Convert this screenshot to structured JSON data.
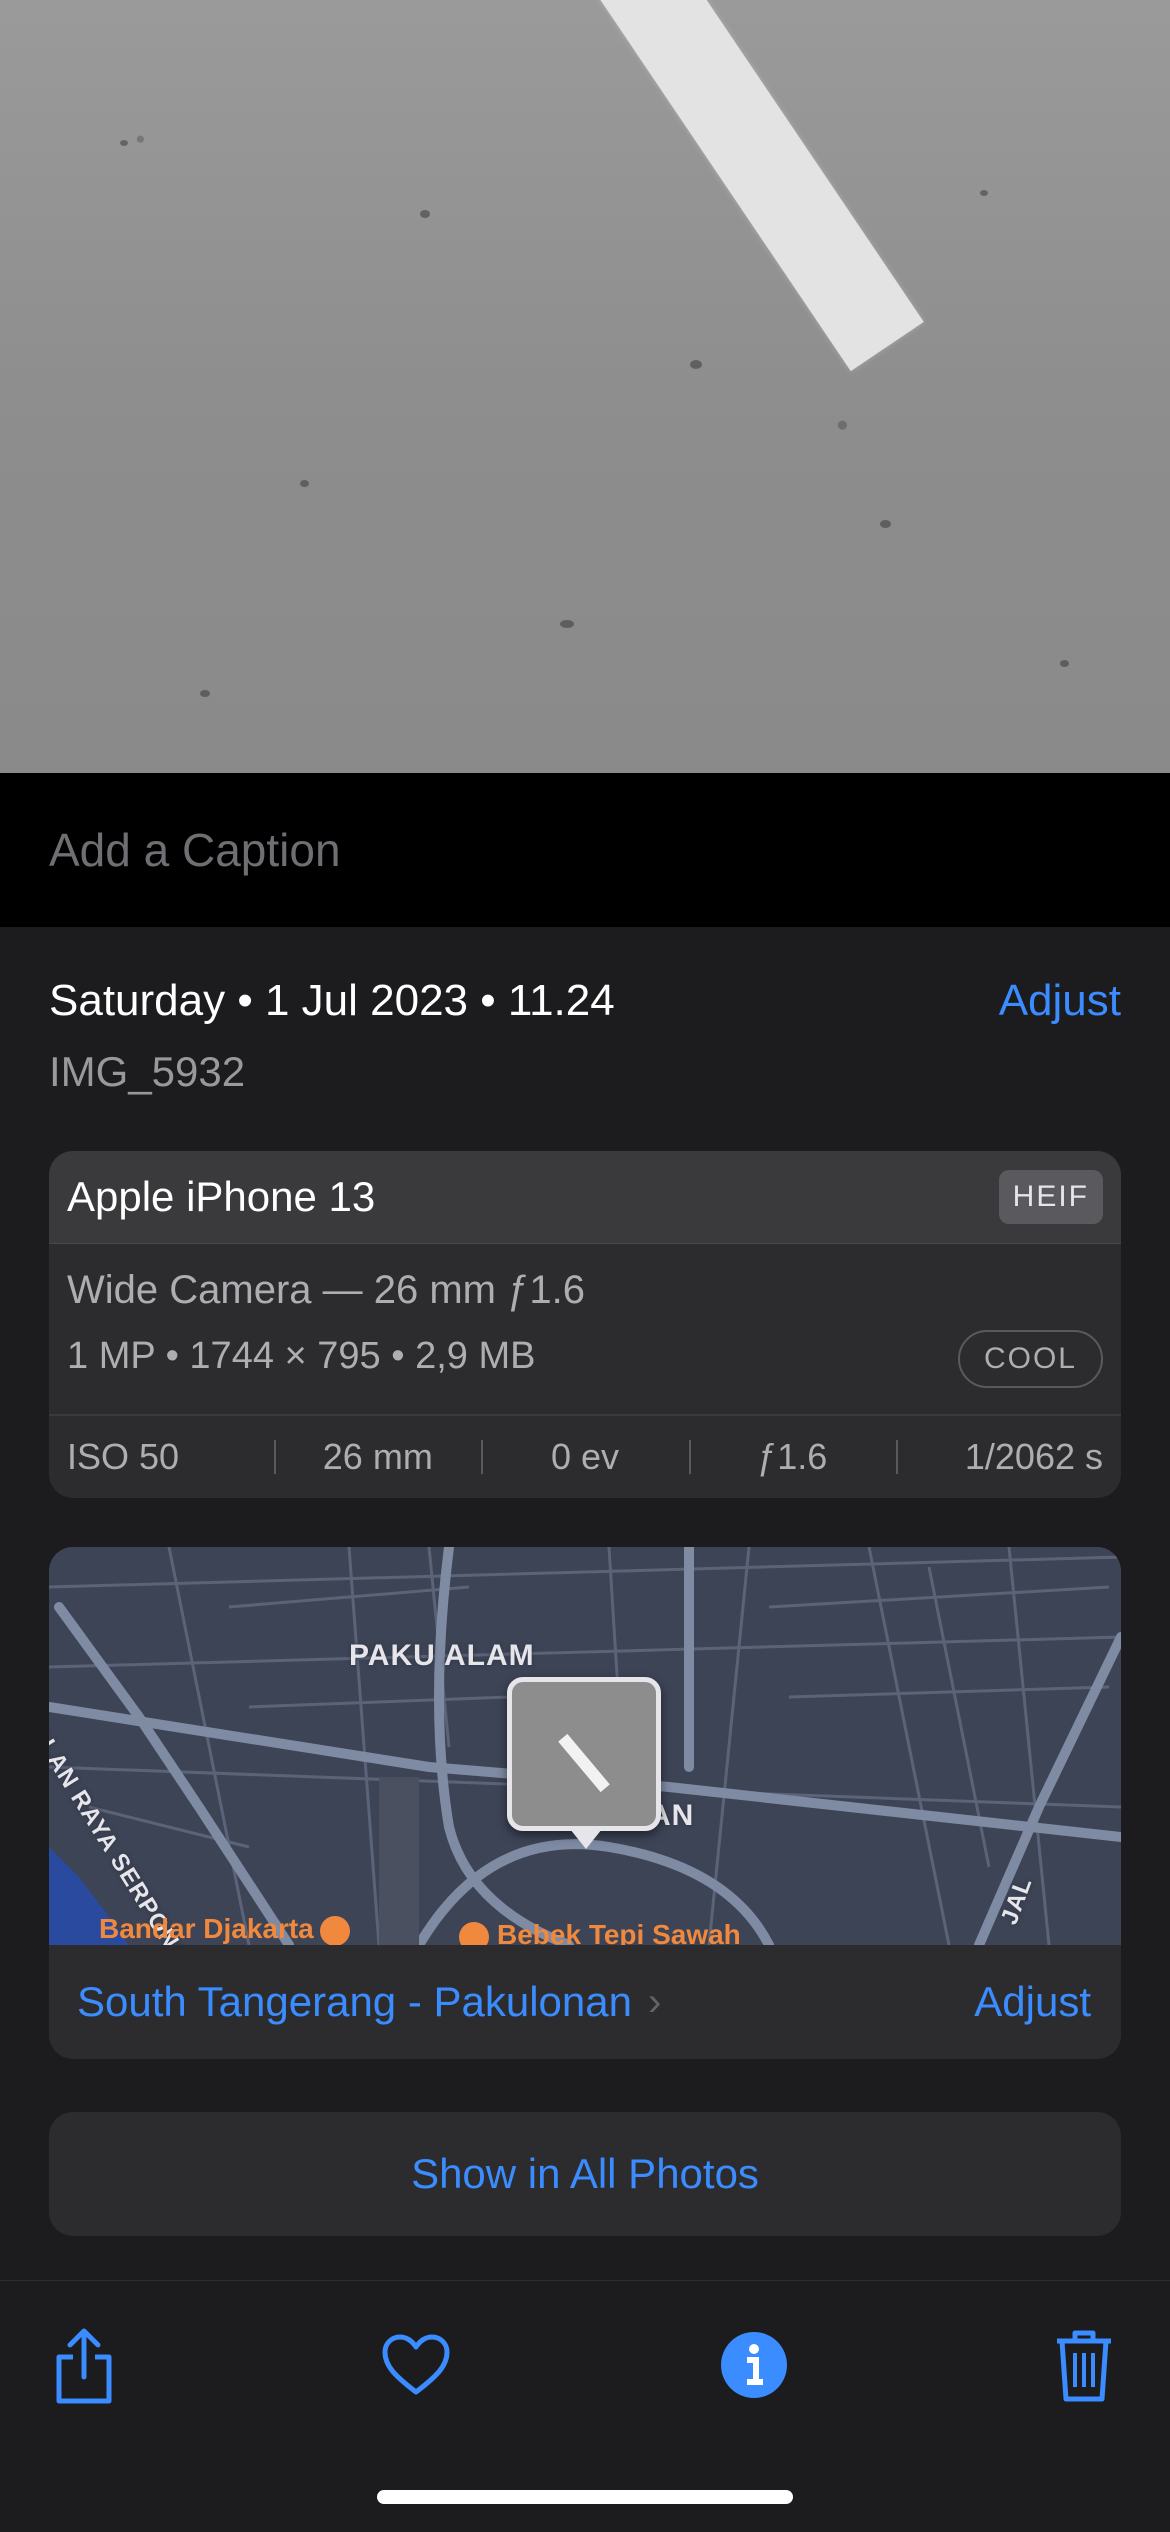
{
  "caption": {
    "placeholder": "Add a Caption"
  },
  "info": {
    "datetime": "Saturday • 1 Jul 2023 • 11.24",
    "adjust_label": "Adjust",
    "filename": "IMG_5932"
  },
  "camera": {
    "model": "Apple iPhone 13",
    "format_badge": "HEIF",
    "lens": "Wide Camera — 26 mm ƒ1.6",
    "specs": "1 MP  •  1744 × 795  •  2,9 MB",
    "filter_badge": "COOL",
    "exif": [
      "ISO 50",
      "26 mm",
      "0 ev",
      "ƒ1.6",
      "1/2062 s"
    ]
  },
  "map": {
    "labels": {
      "district": "PAKU ALAM",
      "road_left": "JALAN RAYA SERPONG",
      "area_partial": "AN",
      "road_right": "JAL"
    },
    "pois": [
      "Bandar Djakarta",
      "Bebek Tepi Sawah"
    ],
    "location": "South Tangerang - Pakulonan",
    "adjust_label": "Adjust"
  },
  "show_all_label": "Show in All Photos",
  "toolbar": {
    "icons": [
      "share-icon",
      "heart-icon",
      "info-icon",
      "trash-icon"
    ]
  },
  "colors": {
    "accent": "#3a8cff",
    "background": "#1c1c1e",
    "card": "#2c2c2e"
  }
}
